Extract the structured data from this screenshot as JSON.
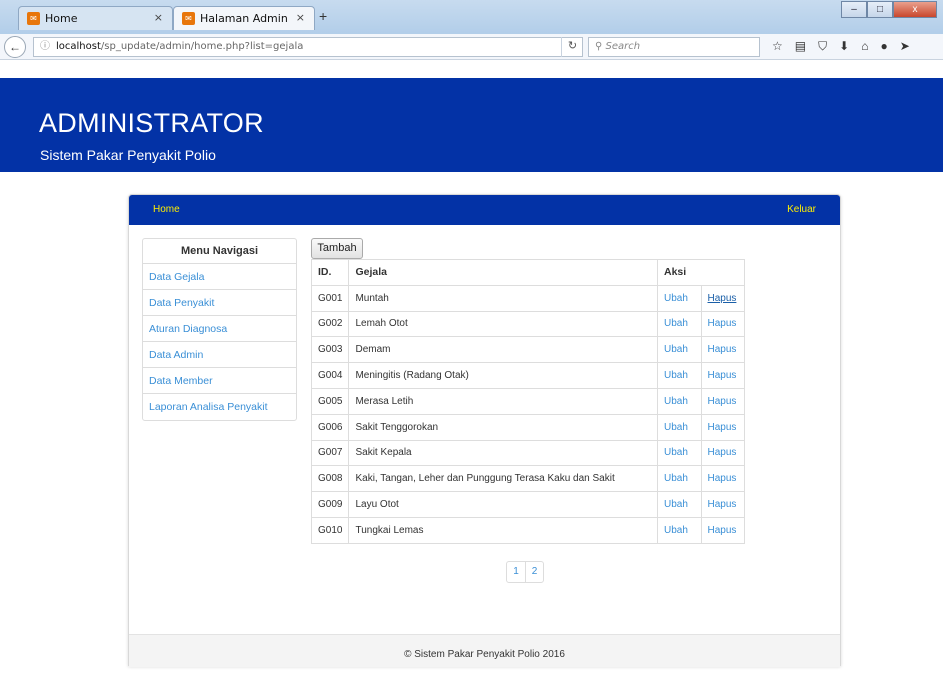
{
  "browser": {
    "tabs": [
      {
        "label": "Home",
        "close": "×"
      },
      {
        "label": "Halaman Admin",
        "close": "×"
      }
    ],
    "new_tab": "+",
    "url_host": "localhost",
    "url_path": "/sp_update/admin/home.php?list=gejala",
    "search_placeholder": "Search",
    "window_buttons": {
      "min": "–",
      "max": "□",
      "close": "x"
    }
  },
  "hero": {
    "title": "ADMINISTRATOR",
    "subtitle": "Sistem Pakar Penyakit Polio"
  },
  "nav": {
    "home": "Home",
    "keluar": "Keluar"
  },
  "menu": {
    "heading": "Menu Navigasi",
    "items": [
      "Data Gejala",
      "Data Penyakit",
      "Aturan Diagnosa",
      "Data Admin",
      "Data Member",
      "Laporan Analisa Penyakit"
    ]
  },
  "actions": {
    "tambah": "Tambah"
  },
  "table": {
    "headers": [
      "ID.",
      "Gejala",
      "Aksi"
    ],
    "rows": [
      {
        "id": "G001",
        "gejala": "Muntah",
        "ubah": "Ubah",
        "hapus": "Hapus"
      },
      {
        "id": "G002",
        "gejala": "Lemah Otot",
        "ubah": "Ubah",
        "hapus": "Hapus"
      },
      {
        "id": "G003",
        "gejala": "Demam",
        "ubah": "Ubah",
        "hapus": "Hapus"
      },
      {
        "id": "G004",
        "gejala": "Meningitis (Radang Otak)",
        "ubah": "Ubah",
        "hapus": "Hapus"
      },
      {
        "id": "G005",
        "gejala": "Merasa Letih",
        "ubah": "Ubah",
        "hapus": "Hapus"
      },
      {
        "id": "G006",
        "gejala": "Sakit Tenggorokan",
        "ubah": "Ubah",
        "hapus": "Hapus"
      },
      {
        "id": "G007",
        "gejala": "Sakit Kepala",
        "ubah": "Ubah",
        "hapus": "Hapus"
      },
      {
        "id": "G008",
        "gejala": "Kaki, Tangan, Leher dan Punggung Terasa Kaku dan Sakit",
        "ubah": "Ubah",
        "hapus": "Hapus"
      },
      {
        "id": "G009",
        "gejala": "Layu Otot",
        "ubah": "Ubah",
        "hapus": "Hapus"
      },
      {
        "id": "G010",
        "gejala": "Tungkai Lemas",
        "ubah": "Ubah",
        "hapus": "Hapus"
      }
    ]
  },
  "pagination": [
    "1",
    "2"
  ],
  "footer": "© Sistem Pakar Penyakit Polio 2016",
  "colors": {
    "brand_blue": "#0332a6",
    "nav_link": "#ffee00",
    "link": "#3a8fd6"
  }
}
